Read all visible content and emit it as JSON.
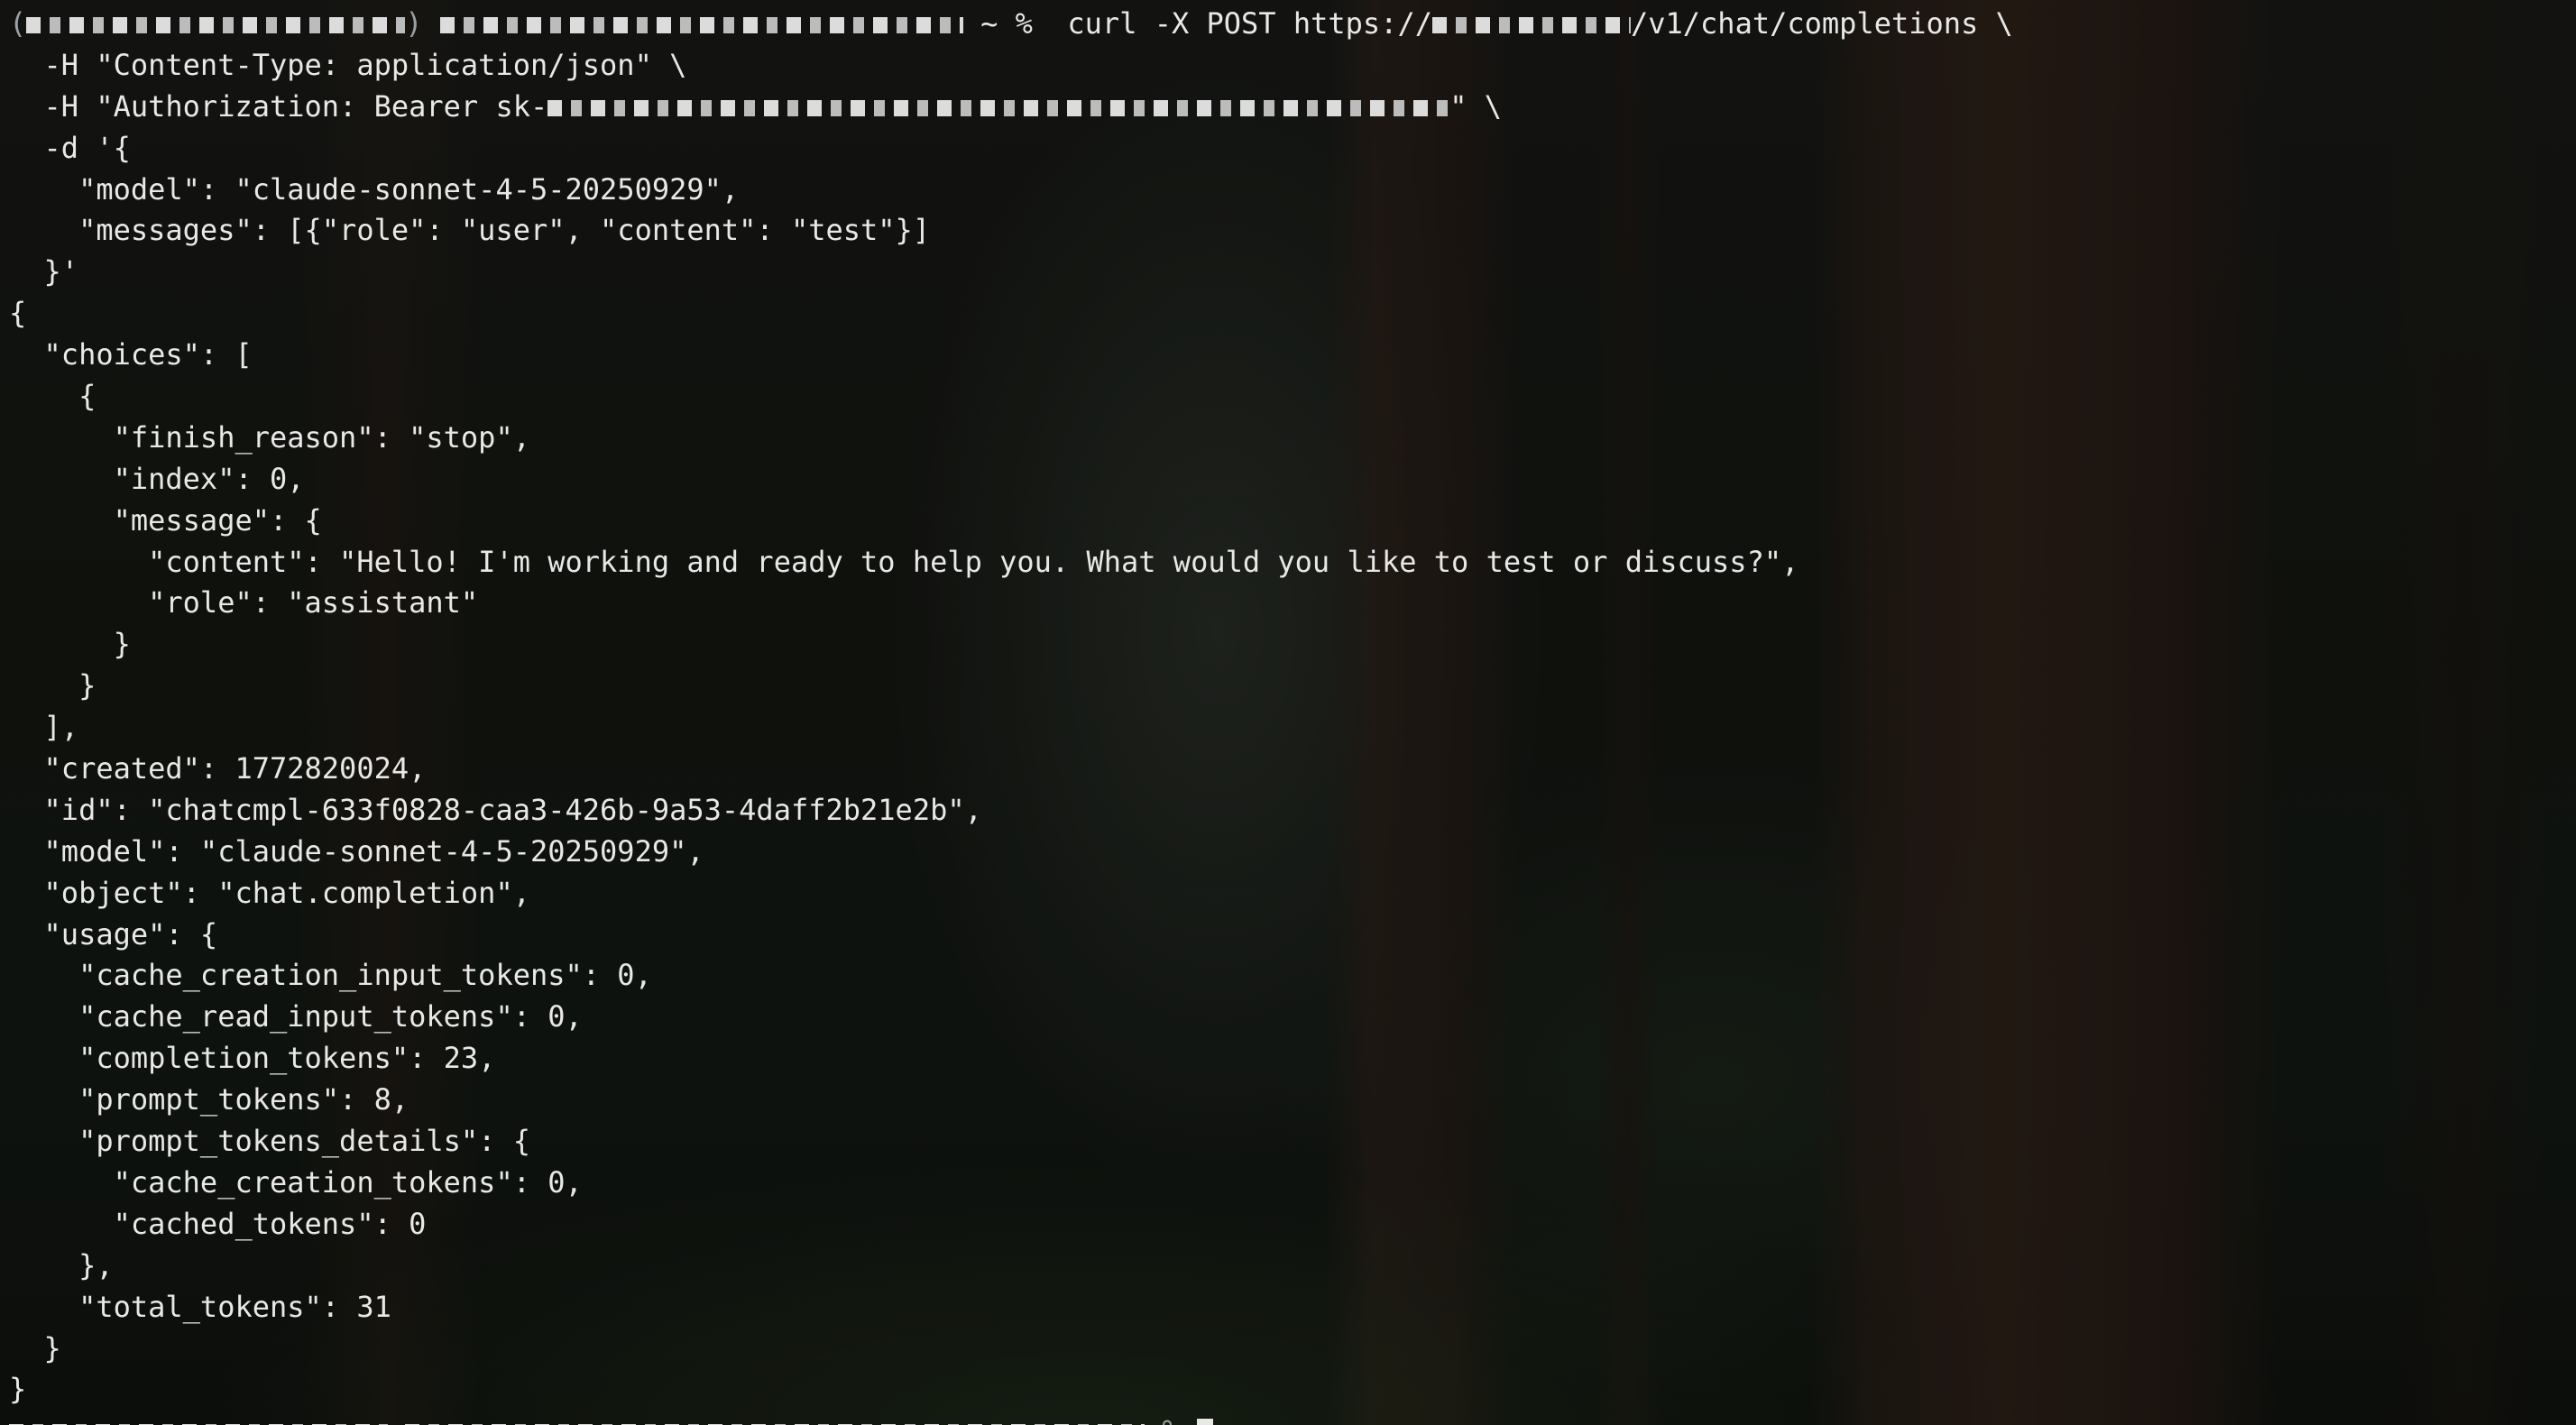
{
  "terminal": {
    "command_lines": [
      "~ %  curl -X POST https://",
      "/v1/chat/completions \\",
      "  -H \"Content-Type: application/json\" \\",
      "  -H \"Authorization: Bearer sk-",
      "\" \\",
      "  -d '{",
      "    \"model\": \"claude-sonnet-4-5-20250929\",",
      "    \"messages\": [{\"role\": \"user\", \"content\": \"test\"}]",
      "  }'"
    ],
    "response_lines": [
      "{",
      "  \"choices\": [",
      "    {",
      "      \"finish_reason\": \"stop\",",
      "      \"index\": 0,",
      "      \"message\": {",
      "        \"content\": \"Hello! I'm working and ready to help you. What would you like to test or discuss?\",",
      "        \"role\": \"assistant\"",
      "      }",
      "    }",
      "  ],",
      "  \"created\": 1772820024,",
      "  \"id\": \"chatcmpl-633f0828-caa3-426b-9a53-4daff2b21e2b\",",
      "  \"model\": \"claude-sonnet-4-5-20250929\",",
      "  \"object\": \"chat.completion\",",
      "  \"usage\": {",
      "    \"cache_creation_input_tokens\": 0,",
      "    \"cache_read_input_tokens\": 0,",
      "    \"completion_tokens\": 23,",
      "    \"prompt_tokens\": 8,",
      "    \"prompt_tokens_details\": {",
      "      \"cache_creation_tokens\": 0,",
      "      \"cached_tokens\": 0",
      "    },",
      "    \"total_tokens\": 31",
      "  }",
      "}"
    ],
    "final_prompt_suffix": "%"
  },
  "colors": {
    "text": "#e8e8e6",
    "background": "#121410"
  },
  "icons": {
    "cursor": "block-cursor-icon"
  }
}
